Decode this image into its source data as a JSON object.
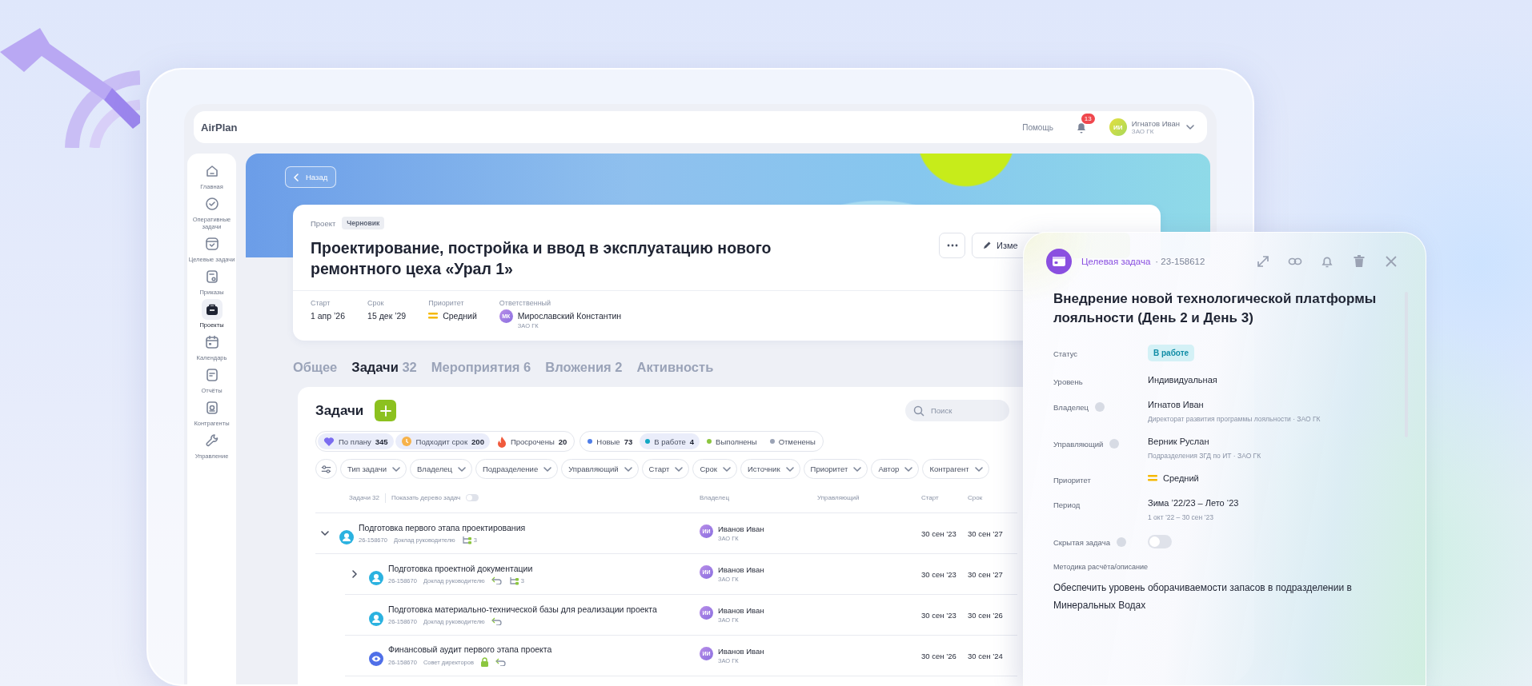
{
  "app": {
    "logo": "AirPlan",
    "help": "Помощь",
    "notifications": "13",
    "user": {
      "initials": "ИИ",
      "name": "Игнатов Иван",
      "org": "ЗАО ГК"
    }
  },
  "sidebar": {
    "items": [
      {
        "label": "Главная",
        "selected": false
      },
      {
        "label": "Оперативные задачи",
        "selected": false
      },
      {
        "label": "Целевые задачи",
        "selected": false
      },
      {
        "label": "Приказы",
        "selected": false
      },
      {
        "label": "Проекты",
        "selected": true
      },
      {
        "label": "Календарь",
        "selected": false
      },
      {
        "label": "Отчёты",
        "selected": false
      },
      {
        "label": "Контрагенты",
        "selected": false
      },
      {
        "label": "Управление",
        "selected": false
      }
    ]
  },
  "back_button": "Назад",
  "project": {
    "type": "Проект",
    "badge": "Черновик",
    "title": "Проектирование, постройка и ввод в эксплуатацию нового ремонтного цеха «Урал 1»",
    "edit_button": "Изме",
    "meta": [
      {
        "kind": "text",
        "label": "Старт",
        "value": "1 апр ’26"
      },
      {
        "kind": "text",
        "label": "Срок",
        "value": "15 дек ’29"
      },
      {
        "kind": "priority",
        "label": "Приоритет",
        "value": "Средний"
      },
      {
        "kind": "person",
        "label": "Ответственный",
        "initials": "МК",
        "value": "Мирославский Константин",
        "sub": "ЗАО ГК"
      }
    ]
  },
  "tabs": [
    {
      "label": "Общее",
      "selected": false
    },
    {
      "label": "Задачи",
      "count": "32",
      "selected": true
    },
    {
      "label": "Мероприятия",
      "count": "6",
      "selected": false
    },
    {
      "label": "Вложения",
      "count": "2",
      "selected": false
    },
    {
      "label": "Активность",
      "selected": false
    }
  ],
  "tasks": {
    "title": "Задачи",
    "search": {
      "placeholder": "Поиск"
    },
    "chip_groups": [
      [
        {
          "kind": "heart",
          "label": "По плану",
          "count": "345",
          "selected": true
        },
        {
          "kind": "clock",
          "label": "Подходит срок",
          "count": "200",
          "selected": true
        },
        {
          "kind": "fire",
          "label": "Просрочены",
          "count": "20",
          "selected": false
        }
      ],
      [
        {
          "kind": "dot",
          "color": "#4f7ee8",
          "label": "Новые",
          "count": "73",
          "selected": false
        },
        {
          "kind": "dot",
          "color": "#12a8c4",
          "label": "В работе",
          "count": "4",
          "selected": true
        },
        {
          "kind": "dot",
          "color": "#8cc63f",
          "label": "Выполнены",
          "selected": false
        },
        {
          "kind": "dot",
          "color": "#9aa3b5",
          "label": "Отменены",
          "selected": false
        }
      ]
    ],
    "filters": [
      "Тип задачи",
      "Владелец",
      "Подразделение",
      "Управляющий",
      "Старт",
      "Срок",
      "Источник",
      "Приоритет",
      "Автор",
      "Контрагент"
    ],
    "table": {
      "count_label": "Задачи 32",
      "tree_toggle": {
        "label": "Показать дерево задач",
        "on": false
      },
      "columns": [
        "Владелец",
        "Управляющий",
        "Старт",
        "Срок"
      ],
      "rows": [
        {
          "kind": "person",
          "title": "Подготовка первого этапа проектирования",
          "id": "26-158670",
          "source": "Доклад руководителю",
          "linked": false,
          "locked": false,
          "subtasks": "3",
          "expanded": true,
          "owner": {
            "initials": "ИИ",
            "name": "Иванов Иван",
            "org": "ЗАО ГК"
          },
          "start": "30 сен ’23",
          "due": "30 сен ’27",
          "children": [
            {
              "kind": "person",
              "title": "Подготовка проектной документации",
              "id": "26-158670",
              "source": "Доклад руководителю",
              "linked": true,
              "locked": false,
              "subtasks": "3",
              "expanded": false,
              "owner": {
                "initials": "ИИ",
                "name": "Иванов Иван",
                "org": "ЗАО ГК"
              },
              "start": "30 сен ’23",
              "due": "30 сен ’27"
            },
            {
              "kind": "person",
              "title": "Подготовка материально-технической базы для реализации проекта",
              "id": "26-158670",
              "source": "Доклад руководителю",
              "linked": true,
              "locked": false,
              "owner": {
                "initials": "ИИ",
                "name": "Иванов Иван",
                "org": "ЗАО ГК"
              },
              "start": "30 сен ’23",
              "due": "30 сен ’26"
            },
            {
              "kind": "review",
              "title": "Финансовый аудит первого этапа проекта",
              "id": "26-158670",
              "source": "Совет директоров",
              "linked": true,
              "locked": true,
              "owner": {
                "initials": "ИИ",
                "name": "Иванов Иван",
                "org": "ЗАО ГК"
              },
              "start": "30 сен ’26",
              "due": "30 сен ’24"
            }
          ]
        }
      ]
    }
  },
  "panel": {
    "type": "Целевая задача",
    "id": "· 23-158612",
    "title": "Внедрение новой технологической платформы лояльности (День 2 и День 3)",
    "fields": [
      {
        "kind": "status",
        "label": "Статус",
        "value": "В работе"
      },
      {
        "kind": "text",
        "label": "Уровень",
        "value": "Индивидуальная"
      },
      {
        "kind": "text",
        "label": "Владелец",
        "help": true,
        "value": "Игнатов Иван",
        "sub": "Директорат развития программы лояльности · ЗАО ГК"
      },
      {
        "kind": "text",
        "label": "Управляющий",
        "help": true,
        "value": "Верник Руслан",
        "sub": "Подразделения ЗГД по ИТ · ЗАО ГК"
      },
      {
        "kind": "priority",
        "label": "Приоритет",
        "value": "Средний"
      },
      {
        "kind": "text",
        "label": "Период",
        "value": "Зима ’22/23 – Лето ‘23",
        "sub": "1 окт ’22 – 30 сен ’23"
      },
      {
        "kind": "toggle",
        "label": "Скрытая задача",
        "help": true,
        "on": false
      }
    ],
    "description_label": "Методика расчёта/описание",
    "description": "Обеспечить уровень оборачиваемости запасов в подразделении в Минеральных Водах"
  }
}
